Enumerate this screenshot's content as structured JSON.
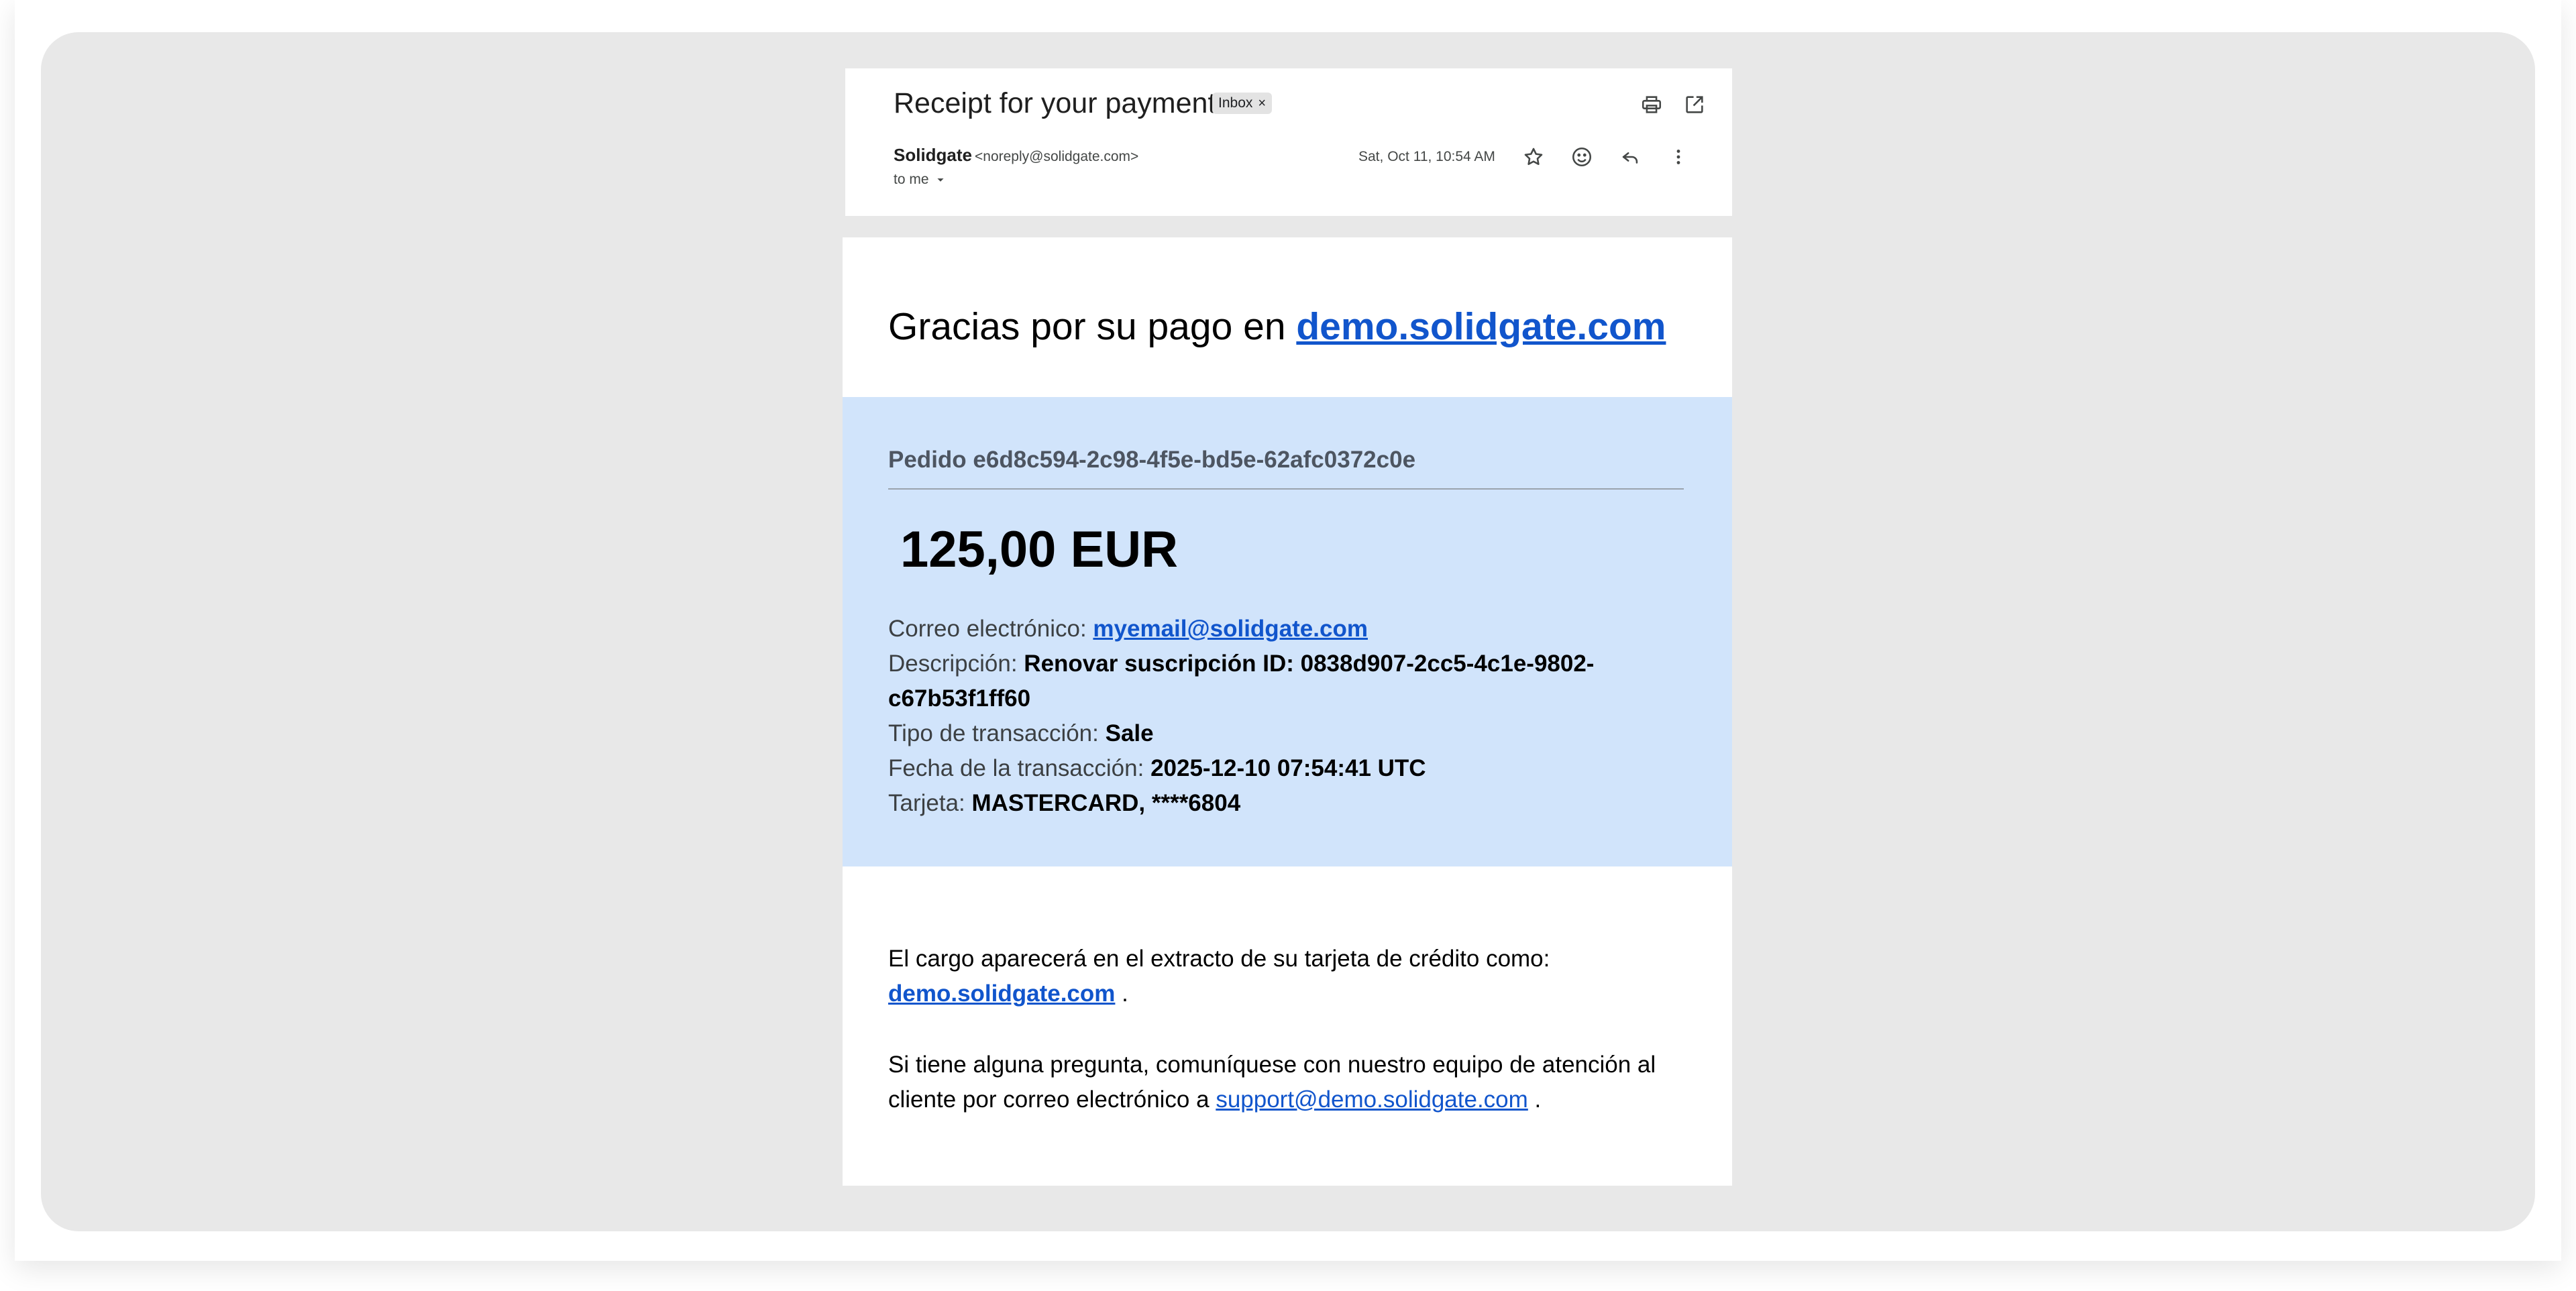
{
  "header": {
    "subject": "Receipt for your payment",
    "label_chip": "Inbox",
    "label_chip_close": "×",
    "sender_name": "Solidgate",
    "sender_email": "<noreply@solidgate.com>",
    "recipient": "to me",
    "date": "Sat, Oct 11, 10:54 AM",
    "icons": [
      "print-icon",
      "open-in-new-window-icon",
      "star-icon",
      "emoji-reaction-icon",
      "reply-icon",
      "more-options-icon"
    ]
  },
  "body": {
    "greeting_prefix": "Gracias por su pago en ",
    "greeting_link": "demo.solidgate.com",
    "order_label": "Pedido e6d8c594-2c98-4f5e-bd5e-62afc0372c0e",
    "amount": "125,00 EUR",
    "email_label": "Correo electrónico: ",
    "email_value": "myemail@solidgate.com",
    "description_label": "Descripción: ",
    "description_value": "Renovar suscripción ID: 0838d907-2cc5-4c1e-9802-c67b53f1ff60",
    "type_label": "Tipo de transacción: ",
    "type_value": "Sale",
    "date_label": "Fecha de la transacción: ",
    "date_value": "2025-12-10 07:54:41 UTC",
    "card_label": "Tarjeta: ",
    "card_value": "MASTERCARD, ****6804",
    "statement_text": "El cargo aparecerá en el extracto de su tarjeta de crédito como: ",
    "statement_link": "demo.solidgate.com",
    "statement_end": " .",
    "support_text": "Si tiene alguna pregunta, comuníquese con nuestro equipo de atención al cliente por correo electrónico a ",
    "support_link": "support@demo.solidgate.com",
    "support_end": " ."
  },
  "colors": {
    "link": "#1155cc",
    "panel": "#d1e4fb",
    "stage": "#e8e8e8"
  }
}
